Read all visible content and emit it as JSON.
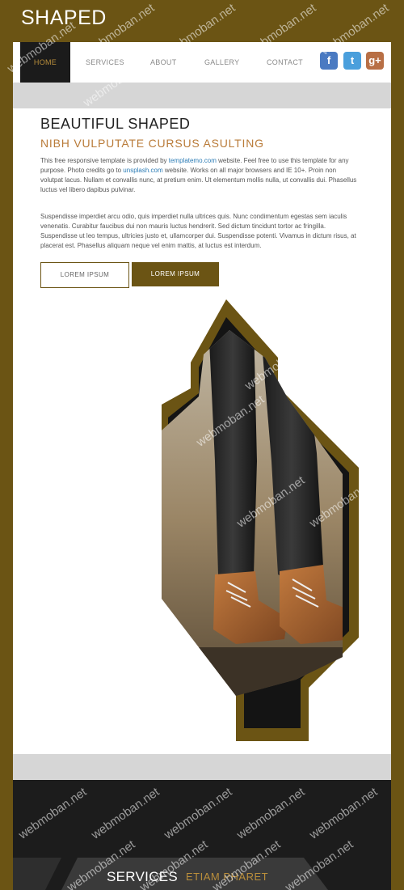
{
  "brand": "SHAPED",
  "nav": {
    "items": [
      "HOME",
      "SERVICES",
      "ABOUT",
      "GALLERY",
      "CONTACT"
    ],
    "active": "HOME"
  },
  "social": {
    "facebook": "f",
    "twitter": "t",
    "googleplus": "g+"
  },
  "intro": {
    "title": "BEAUTIFUL SHAPED",
    "subtitle": "NIBH VULPUTATE CURSUS ASULTING",
    "p1_a": "This free responsive template is provided by ",
    "p1_link1": "templatemo.com",
    "p1_b": " website. Feel free to use this template for any purpose. Photo credits go to ",
    "p1_link2": "unsplash.com",
    "p1_c": " website. Works on all major browsers and IE 10+. Proin non volutpat lacus. Nullam et convallis nunc, at pretium enim. Ut elementum mollis nulla, ut convallis dui. Phasellus luctus vel libero dapibus pulvinar.",
    "p2": "Suspendisse imperdiet arcu odio, quis imperdiet nulla ultrices quis. Nunc condimentum egestas sem iaculis venenatis. Curabitur faucibus dui non mauris luctus hendrerit. Sed dictum tincidunt tortor ac fringilla. Suspendisse ut leo tempus, ultricies justo et, ullamcorper dui. Suspendisse potenti. Vivamus in dictum risus, at placerat est. Phasellus aliquam neque vel enim mattis, at luctus est interdum.",
    "button1": "LOREM IPSUM",
    "button2": "LOREM IPSUM"
  },
  "services": {
    "title": "SERVICES",
    "subtitle": "ETIAM PHARET"
  },
  "watermark": "webmoban.net",
  "colors": {
    "brand_bg": "#6b5414",
    "accent": "#b97b39",
    "dark": "#1c1c1c",
    "link": "#2a7bb5"
  }
}
